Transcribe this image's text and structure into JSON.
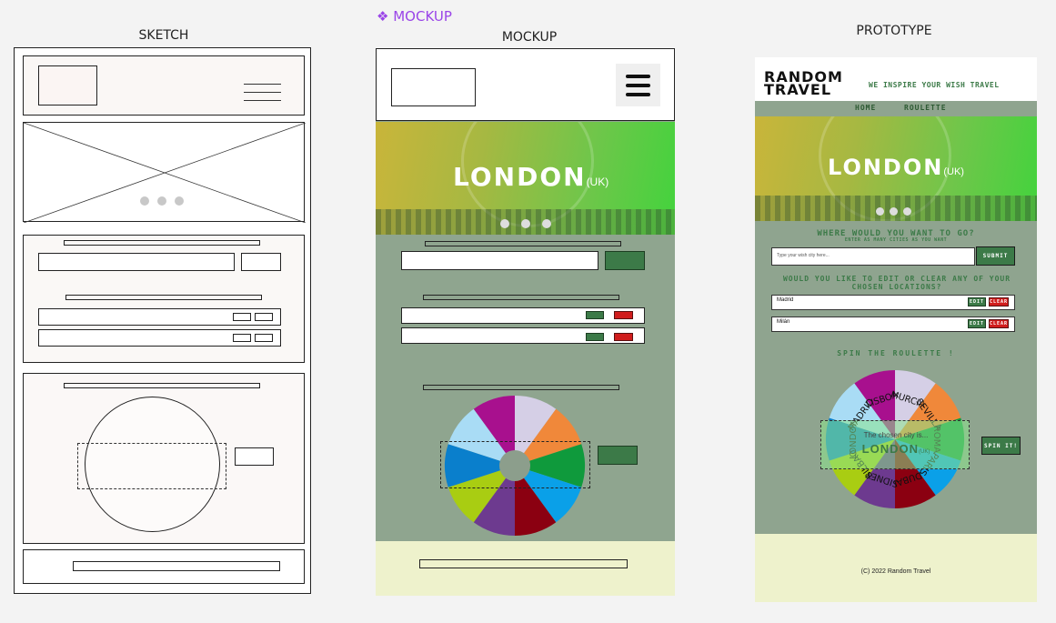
{
  "tag": "❖ MOCKUP",
  "labels": {
    "sketch": "SKETCH",
    "mockup": "MOCKUP",
    "prototype": "PROTOTYPE"
  },
  "mockup": {
    "hero_title": "LONDON",
    "hero_sub": "(UK)"
  },
  "prototype": {
    "logo_line1": "RANDOM",
    "logo_line2": "TRAVEL",
    "tagline": "WE INSPIRE YOUR WISH TRAVEL",
    "nav": [
      "HOME",
      "ROULETTE"
    ],
    "hero_title": "LONDON",
    "hero_sub": "(UK)",
    "form_title": "WHERE WOULD YOU WANT TO GO?",
    "form_hint": "ENTER AS MANY CITIES AS YOU WANT",
    "input_placeholder": "Type your wish city here...",
    "submit": "SUBMIT",
    "edit_title": "WOULD YOU LIKE TO EDIT OR CLEAR ANY OF YOUR CHOSEN LOCATIONS?",
    "cities": [
      "Madrid",
      "Milán"
    ],
    "edit": "EDIT",
    "clear": "CLEAR",
    "roulette_title": "SPIN THE ROULETTE !",
    "wheel_labels": [
      "LISBOA",
      "MURCIA",
      "SEVILLA",
      "ROMA",
      "PARIS",
      "DUBAI",
      "SIDNEY",
      "BILBAO",
      "LONDON",
      "MADRID"
    ],
    "chosen_text": "The chosen city is...",
    "chosen_city": "LONDON",
    "chosen_sub": "(UK)",
    "spin": "SPIN IT!",
    "footer": "(C) 2022  Random Travel"
  },
  "colors": {
    "wheel": [
      "#a8108e",
      "#d5cfe6",
      "#f0883a",
      "#0f9a3c",
      "#0aa0e8",
      "#8b0011",
      "#6d3a8f",
      "#a9cd12",
      "#0a7fcc",
      "#a9dcf5"
    ]
  }
}
